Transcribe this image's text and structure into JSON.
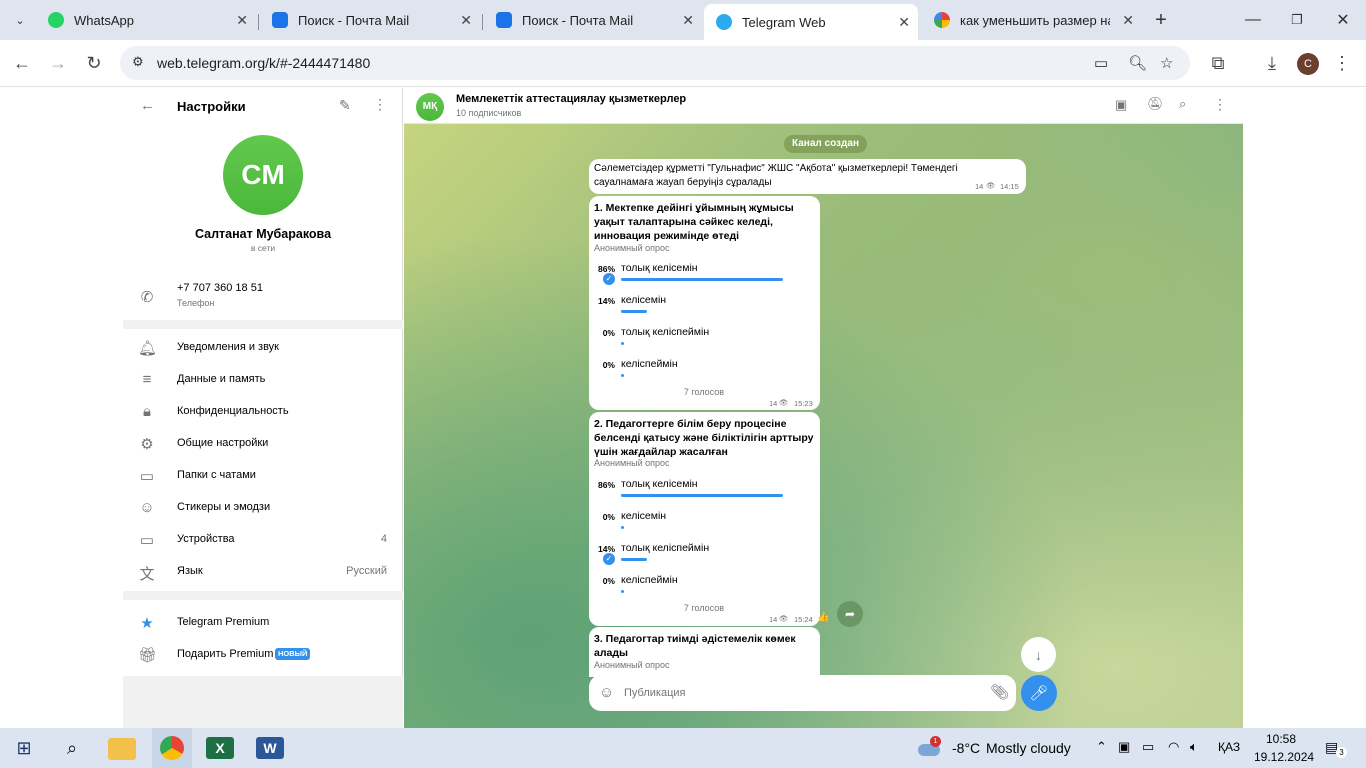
{
  "browser": {
    "tabs": [
      {
        "label": "WhatsApp",
        "color": "#25d366"
      },
      {
        "label": "Поиск - Почта Mail",
        "color": "#1a73e8"
      },
      {
        "label": "Поиск - Почта Mail",
        "color": "#1a73e8"
      },
      {
        "label": "Telegram Web",
        "color": "#2aabee"
      },
      {
        "label": "как уменьшить размер на",
        "color": "#ea4335"
      }
    ],
    "url": "web.telegram.org/k/#-2444471480",
    "profile_initial": "C"
  },
  "settings": {
    "title": "Настройки",
    "avatar_initials": "CM",
    "name": "Салтанат Мубаракова",
    "status": "в сети",
    "phone": "+7 707 360 18 51",
    "phone_label": "Телефон",
    "menu": [
      {
        "label": "Уведомления и звук",
        "value": ""
      },
      {
        "label": "Данные и память",
        "value": ""
      },
      {
        "label": "Конфиденциальность",
        "value": ""
      },
      {
        "label": "Общие настройки",
        "value": ""
      },
      {
        "label": "Папки с чатами",
        "value": ""
      },
      {
        "label": "Стикеры и эмодзи",
        "value": ""
      },
      {
        "label": "Устройства",
        "value": "4"
      },
      {
        "label": "Язык",
        "value": "Русский"
      }
    ],
    "premium_label": "Telegram Premium",
    "gift_label": "Подарить Premium",
    "new_badge": "НОВЫЙ"
  },
  "chat": {
    "avatar": "МҚ",
    "title": "Мемлекеттік аттестациялау қызметкерлер",
    "subtitle": "10 подписчиков",
    "service": "Канал создан",
    "msg1": {
      "text": "Сәлеметсіздер құрметті \"Гульнафис\" ЖШС \"Ақбота\" қызметкерлері! Төмендегі сауалнамаға жауап беруіңіз сұралады",
      "views": "14",
      "time": "14:15"
    },
    "poll1": {
      "question": "1. Мектепке дейінгі ұйымның жұмысы уақыт талаптарына сәйкес келеді, инновация режимінде өтеді",
      "anon": "Анонимный опрос",
      "options": [
        {
          "pct": "86%",
          "label": "толық келісемін",
          "fraction": 0.86,
          "chosen": true
        },
        {
          "pct": "14%",
          "label": "келісемін",
          "fraction": 0.14,
          "chosen": false
        },
        {
          "pct": "0%",
          "label": "толық келіспеймін",
          "fraction": 0,
          "chosen": false
        },
        {
          "pct": "0%",
          "label": "келіспеймін",
          "fraction": 0,
          "chosen": false
        }
      ],
      "votes": "7 голосов",
      "views": "14",
      "time": "15:23"
    },
    "poll2": {
      "question": "2. Педагогтерге білім беру процесіне белсенді қатысу және біліктілігін арттыру үшін жағдайлар жасалған",
      "anon": "Анонимный опрос",
      "options": [
        {
          "pct": "86%",
          "label": "толық келісемін",
          "fraction": 0.86,
          "chosen": false
        },
        {
          "pct": "0%",
          "label": "келісемін",
          "fraction": 0,
          "chosen": false
        },
        {
          "pct": "14%",
          "label": "толық келіспеймін",
          "fraction": 0.14,
          "chosen": true
        },
        {
          "pct": "0%",
          "label": "келіспеймін",
          "fraction": 0,
          "chosen": false
        }
      ],
      "votes": "7 голосов",
      "views": "14",
      "time": "15:24",
      "reaction": "👍"
    },
    "poll3": {
      "question": "3. Педагогтар тиімді әдістемелік көмек алады",
      "anon": "Анонимный опрос"
    },
    "input_placeholder": "Публикация"
  },
  "taskbar": {
    "weather_temp": "-8°C",
    "weather_text": "Mostly cloudy",
    "weather_badge": "1",
    "lang": "ҚАЗ",
    "time": "10:58",
    "date": "19.12.2024",
    "notif_count": "3"
  }
}
